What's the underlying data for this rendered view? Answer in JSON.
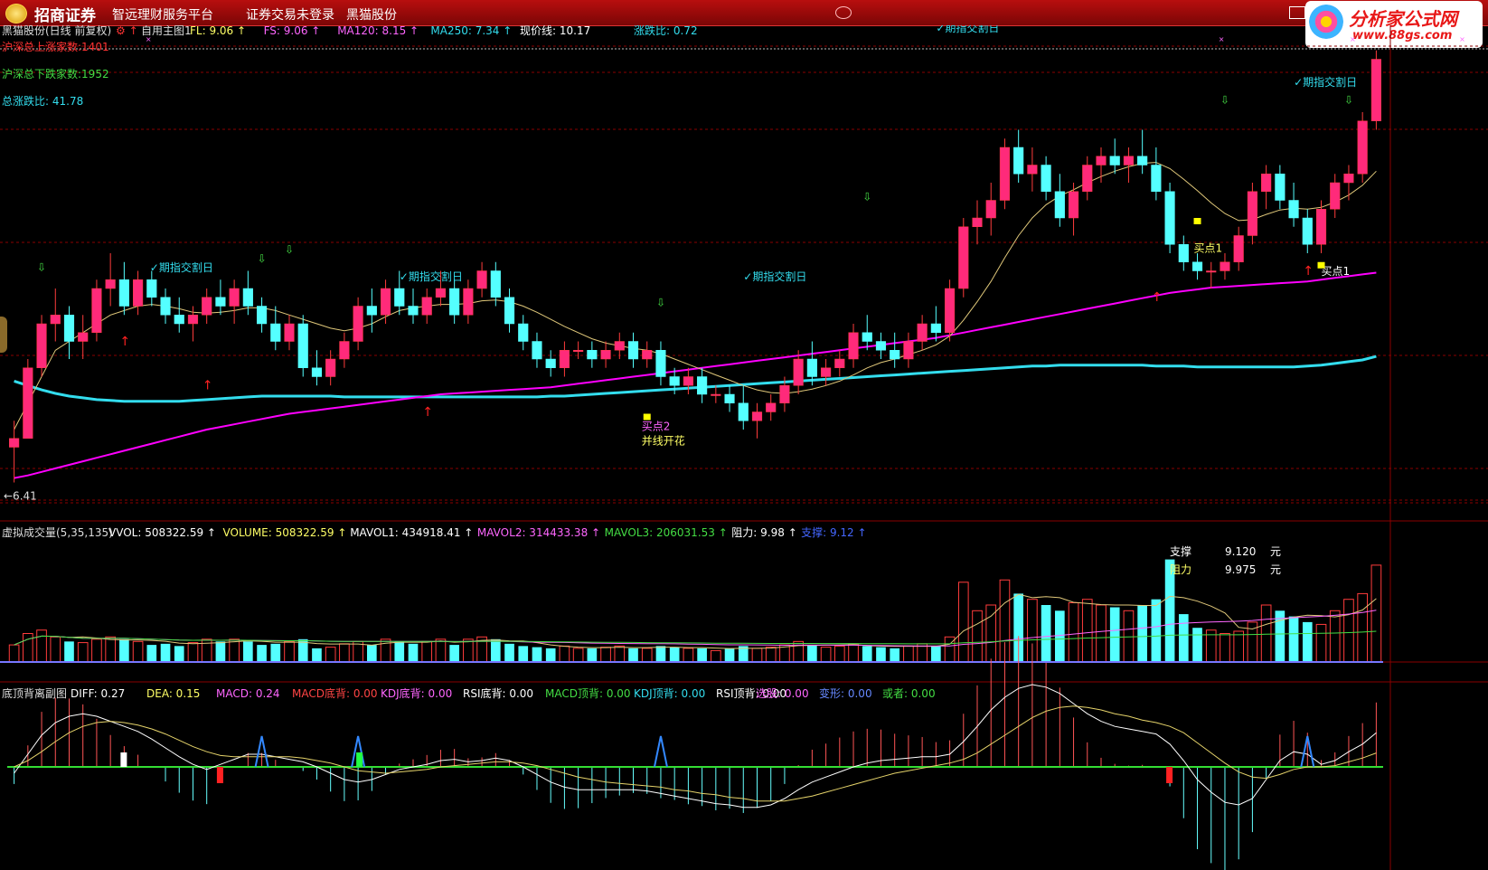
{
  "app": {
    "brand": "招商证券",
    "tagline": "智远理财服务平台",
    "login_status": "证券交易未登录",
    "stock_name": "黑猫股份",
    "watermark_name": "分析家公式网",
    "watermark_url": "www.88gs.com"
  },
  "colors": {
    "up": "#ff3c3c",
    "down": "#54ffff",
    "ma_main": "#e0c87a",
    "ma120": "#ff00ff",
    "ma250": "#33ddee",
    "price_line": "#c8c8c8",
    "grid": "#8a0000",
    "support": "#ffffff",
    "diff": "#ffffff",
    "dea": "#e5d36a",
    "zero_line": "#33dd33"
  },
  "main_panel": {
    "title": "黑猫股份(日线 前复权)",
    "indicator_name": "自用主图1",
    "legend": [
      {
        "text": "FL: 9.06",
        "color": "#ffff66"
      },
      {
        "text": "FS: 9.06",
        "color": "#ff66ff"
      },
      {
        "text": "MA120: 8.15",
        "color": "#ff66ff"
      },
      {
        "text": "MA250: 7.34",
        "color": "#33ddee"
      }
    ],
    "current_price_label": "现价线: 10.17",
    "ratio_label": "涨跌比: 0.72",
    "stats": [
      {
        "text": "沪深总上涨家数:1401",
        "color": "#ff3333"
      },
      {
        "text": "沪深总下跌家数:1952",
        "color": "#44dd44"
      },
      {
        "text": "总涨跌比: 41.78",
        "color": "#33ddee"
      }
    ],
    "low_label": "6.41",
    "expiry_label": "✓期指交割日",
    "buy_label_1": "买点1",
    "buy_label_2": "买点2",
    "blossom_label": "并线开花"
  },
  "volume_panel": {
    "title": "虚拟成交量(5,35,135)",
    "legend": [
      {
        "text": "VVOL: 508322.59",
        "color": "#ffffff"
      },
      {
        "text": "VOLUME: 508322.59",
        "color": "#ffff66"
      },
      {
        "text": "MAVOL1: 434918.41",
        "color": "#ffffff"
      },
      {
        "text": "MAVOL2: 314433.38",
        "color": "#ff66ff"
      },
      {
        "text": "MAVOL3: 206031.53",
        "color": "#44dd44"
      },
      {
        "text": "阻力: 9.98",
        "color": "#ffffff"
      },
      {
        "text": "支撑: 9.12",
        "color": "#4466ff"
      }
    ],
    "support_label": "支撑",
    "support_value": "9.120",
    "resistance_label": "阻力",
    "resistance_value": "9.975",
    "unit": "元"
  },
  "macd_panel": {
    "title": "底顶背离副图",
    "legend": [
      {
        "text": "DIFF: 0.27",
        "color": "#ffffff"
      },
      {
        "text": "DEA: 0.15",
        "color": "#ffff66"
      },
      {
        "text": "MACD: 0.24",
        "color": "#ff66ff"
      },
      {
        "text": "MACD底背: 0.00",
        "color": "#ff4444"
      },
      {
        "text": "KDJ底背: 0.00",
        "color": "#ff66ff"
      },
      {
        "text": "RSI底背: 0.00",
        "color": "#ffffff"
      },
      {
        "text": "MACD顶背: 0.00",
        "color": "#44dd44"
      },
      {
        "text": "KDJ顶背: 0.00",
        "color": "#33ddee"
      },
      {
        "text": "RSI顶背: 0.00",
        "color": "#ffffff"
      },
      {
        "text": "选股: 0.00",
        "color": "#ff66ff"
      },
      {
        "text": "变形: 0.00",
        "color": "#6688ff"
      },
      {
        "text": "或者: 0.00",
        "color": "#44dd44"
      }
    ]
  },
  "chart_data": {
    "type": "candlestick",
    "price_low": 6.41,
    "price_range": [
      6.2,
      11.4
    ],
    "candles": [
      {
        "o": 6.8,
        "h": 7.1,
        "l": 6.4,
        "c": 6.9
      },
      {
        "o": 6.9,
        "h": 7.8,
        "l": 6.9,
        "c": 7.7
      },
      {
        "o": 7.7,
        "h": 8.3,
        "l": 7.6,
        "c": 8.2
      },
      {
        "o": 8.2,
        "h": 8.6,
        "l": 8.0,
        "c": 8.3
      },
      {
        "o": 8.3,
        "h": 8.4,
        "l": 7.8,
        "c": 8.0
      },
      {
        "o": 8.0,
        "h": 8.3,
        "l": 7.8,
        "c": 8.1
      },
      {
        "o": 8.1,
        "h": 8.7,
        "l": 8.0,
        "c": 8.6
      },
      {
        "o": 8.6,
        "h": 9.0,
        "l": 8.4,
        "c": 8.7
      },
      {
        "o": 8.7,
        "h": 8.9,
        "l": 8.3,
        "c": 8.4
      },
      {
        "o": 8.4,
        "h": 8.8,
        "l": 8.3,
        "c": 8.7
      },
      {
        "o": 8.7,
        "h": 8.8,
        "l": 8.4,
        "c": 8.5
      },
      {
        "o": 8.5,
        "h": 8.6,
        "l": 8.2,
        "c": 8.3
      },
      {
        "o": 8.3,
        "h": 8.5,
        "l": 8.1,
        "c": 8.2
      },
      {
        "o": 8.2,
        "h": 8.4,
        "l": 8.0,
        "c": 8.3
      },
      {
        "o": 8.3,
        "h": 8.6,
        "l": 8.2,
        "c": 8.5
      },
      {
        "o": 8.5,
        "h": 8.7,
        "l": 8.3,
        "c": 8.4
      },
      {
        "o": 8.4,
        "h": 8.7,
        "l": 8.2,
        "c": 8.6
      },
      {
        "o": 8.6,
        "h": 8.8,
        "l": 8.3,
        "c": 8.4
      },
      {
        "o": 8.4,
        "h": 8.5,
        "l": 8.1,
        "c": 8.2
      },
      {
        "o": 8.2,
        "h": 8.4,
        "l": 7.9,
        "c": 8.0
      },
      {
        "o": 8.0,
        "h": 8.3,
        "l": 7.9,
        "c": 8.2
      },
      {
        "o": 8.2,
        "h": 8.3,
        "l": 7.6,
        "c": 7.7
      },
      {
        "o": 7.7,
        "h": 7.9,
        "l": 7.5,
        "c": 7.6
      },
      {
        "o": 7.6,
        "h": 7.9,
        "l": 7.5,
        "c": 7.8
      },
      {
        "o": 7.8,
        "h": 8.1,
        "l": 7.7,
        "c": 8.0
      },
      {
        "o": 8.0,
        "h": 8.5,
        "l": 7.9,
        "c": 8.4
      },
      {
        "o": 8.4,
        "h": 8.6,
        "l": 8.1,
        "c": 8.3
      },
      {
        "o": 8.3,
        "h": 8.7,
        "l": 8.2,
        "c": 8.6
      },
      {
        "o": 8.6,
        "h": 8.8,
        "l": 8.3,
        "c": 8.4
      },
      {
        "o": 8.4,
        "h": 8.6,
        "l": 8.2,
        "c": 8.3
      },
      {
        "o": 8.3,
        "h": 8.6,
        "l": 8.2,
        "c": 8.5
      },
      {
        "o": 8.5,
        "h": 8.8,
        "l": 8.4,
        "c": 8.6
      },
      {
        "o": 8.6,
        "h": 8.7,
        "l": 8.2,
        "c": 8.3
      },
      {
        "o": 8.3,
        "h": 8.7,
        "l": 8.2,
        "c": 8.6
      },
      {
        "o": 8.6,
        "h": 8.9,
        "l": 8.5,
        "c": 8.8
      },
      {
        "o": 8.8,
        "h": 8.9,
        "l": 8.4,
        "c": 8.5
      },
      {
        "o": 8.5,
        "h": 8.6,
        "l": 8.1,
        "c": 8.2
      },
      {
        "o": 8.2,
        "h": 8.3,
        "l": 7.9,
        "c": 8.0
      },
      {
        "o": 8.0,
        "h": 8.1,
        "l": 7.7,
        "c": 7.8
      },
      {
        "o": 7.8,
        "h": 7.9,
        "l": 7.6,
        "c": 7.7
      },
      {
        "o": 7.7,
        "h": 8.0,
        "l": 7.6,
        "c": 7.9
      },
      {
        "o": 7.9,
        "h": 8.0,
        "l": 7.8,
        "c": 7.9
      },
      {
        "o": 7.9,
        "h": 8.0,
        "l": 7.7,
        "c": 7.8
      },
      {
        "o": 7.8,
        "h": 8.0,
        "l": 7.7,
        "c": 7.9
      },
      {
        "o": 7.9,
        "h": 8.1,
        "l": 7.8,
        "c": 8.0
      },
      {
        "o": 8.0,
        "h": 8.1,
        "l": 7.7,
        "c": 7.8
      },
      {
        "o": 7.8,
        "h": 8.0,
        "l": 7.7,
        "c": 7.9
      },
      {
        "o": 7.9,
        "h": 8.0,
        "l": 7.5,
        "c": 7.6
      },
      {
        "o": 7.6,
        "h": 7.7,
        "l": 7.4,
        "c": 7.5
      },
      {
        "o": 7.5,
        "h": 7.7,
        "l": 7.4,
        "c": 7.6
      },
      {
        "o": 7.6,
        "h": 7.7,
        "l": 7.3,
        "c": 7.4
      },
      {
        "o": 7.4,
        "h": 7.5,
        "l": 7.3,
        "c": 7.4
      },
      {
        "o": 7.4,
        "h": 7.5,
        "l": 7.2,
        "c": 7.3
      },
      {
        "o": 7.3,
        "h": 7.5,
        "l": 7.0,
        "c": 7.1
      },
      {
        "o": 7.1,
        "h": 7.3,
        "l": 6.9,
        "c": 7.2
      },
      {
        "o": 7.2,
        "h": 7.4,
        "l": 7.1,
        "c": 7.3
      },
      {
        "o": 7.3,
        "h": 7.6,
        "l": 7.2,
        "c": 7.5
      },
      {
        "o": 7.5,
        "h": 7.9,
        "l": 7.4,
        "c": 7.8
      },
      {
        "o": 7.8,
        "h": 8.0,
        "l": 7.5,
        "c": 7.6
      },
      {
        "o": 7.6,
        "h": 7.8,
        "l": 7.5,
        "c": 7.7
      },
      {
        "o": 7.7,
        "h": 7.9,
        "l": 7.6,
        "c": 7.8
      },
      {
        "o": 7.8,
        "h": 8.2,
        "l": 7.7,
        "c": 8.1
      },
      {
        "o": 8.1,
        "h": 8.3,
        "l": 7.9,
        "c": 8.0
      },
      {
        "o": 8.0,
        "h": 8.1,
        "l": 7.8,
        "c": 7.9
      },
      {
        "o": 7.9,
        "h": 8.1,
        "l": 7.7,
        "c": 7.8
      },
      {
        "o": 7.8,
        "h": 8.1,
        "l": 7.7,
        "c": 8.0
      },
      {
        "o": 8.0,
        "h": 8.3,
        "l": 7.9,
        "c": 8.2
      },
      {
        "o": 8.2,
        "h": 8.4,
        "l": 8.0,
        "c": 8.1
      },
      {
        "o": 8.1,
        "h": 8.7,
        "l": 8.0,
        "c": 8.6
      },
      {
        "o": 8.6,
        "h": 9.4,
        "l": 8.5,
        "c": 9.3
      },
      {
        "o": 9.3,
        "h": 9.6,
        "l": 9.1,
        "c": 9.4
      },
      {
        "o": 9.4,
        "h": 9.8,
        "l": 9.2,
        "c": 9.6
      },
      {
        "o": 9.6,
        "h": 10.3,
        "l": 9.5,
        "c": 10.2
      },
      {
        "o": 10.2,
        "h": 10.4,
        "l": 9.8,
        "c": 9.9
      },
      {
        "o": 9.9,
        "h": 10.2,
        "l": 9.7,
        "c": 10.0
      },
      {
        "o": 10.0,
        "h": 10.1,
        "l": 9.6,
        "c": 9.7
      },
      {
        "o": 9.7,
        "h": 9.9,
        "l": 9.3,
        "c": 9.4
      },
      {
        "o": 9.4,
        "h": 9.8,
        "l": 9.2,
        "c": 9.7
      },
      {
        "o": 9.7,
        "h": 10.1,
        "l": 9.6,
        "c": 10.0
      },
      {
        "o": 10.0,
        "h": 10.2,
        "l": 9.8,
        "c": 10.1
      },
      {
        "o": 10.1,
        "h": 10.3,
        "l": 9.9,
        "c": 10.0
      },
      {
        "o": 10.0,
        "h": 10.2,
        "l": 9.8,
        "c": 10.1
      },
      {
        "o": 10.1,
        "h": 10.4,
        "l": 9.9,
        "c": 10.0
      },
      {
        "o": 10.0,
        "h": 10.2,
        "l": 9.6,
        "c": 9.7
      },
      {
        "o": 9.7,
        "h": 9.8,
        "l": 9.0,
        "c": 9.1
      },
      {
        "o": 9.1,
        "h": 9.2,
        "l": 8.8,
        "c": 8.9
      },
      {
        "o": 8.9,
        "h": 9.0,
        "l": 8.7,
        "c": 8.8
      },
      {
        "o": 8.8,
        "h": 8.9,
        "l": 8.6,
        "c": 8.8
      },
      {
        "o": 8.8,
        "h": 9.0,
        "l": 8.7,
        "c": 8.9
      },
      {
        "o": 8.9,
        "h": 9.3,
        "l": 8.8,
        "c": 9.2
      },
      {
        "o": 9.2,
        "h": 9.8,
        "l": 9.1,
        "c": 9.7
      },
      {
        "o": 9.7,
        "h": 10.0,
        "l": 9.5,
        "c": 9.9
      },
      {
        "o": 9.9,
        "h": 10.0,
        "l": 9.5,
        "c": 9.6
      },
      {
        "o": 9.6,
        "h": 9.8,
        "l": 9.3,
        "c": 9.4
      },
      {
        "o": 9.4,
        "h": 9.5,
        "l": 9.0,
        "c": 9.1
      },
      {
        "o": 9.1,
        "h": 9.6,
        "l": 9.0,
        "c": 9.5
      },
      {
        "o": 9.5,
        "h": 9.9,
        "l": 9.4,
        "c": 9.8
      },
      {
        "o": 9.8,
        "h": 10.0,
        "l": 9.6,
        "c": 9.9
      },
      {
        "o": 9.9,
        "h": 10.6,
        "l": 9.8,
        "c": 10.5
      },
      {
        "o": 10.5,
        "h": 11.3,
        "l": 10.4,
        "c": 11.2
      }
    ],
    "ma_main": [
      7.0,
      7.3,
      7.6,
      7.9,
      8.0,
      8.1,
      8.2,
      8.3,
      8.35,
      8.4,
      8.42,
      8.4,
      8.37,
      8.33,
      8.32,
      8.33,
      8.35,
      8.38,
      8.38,
      8.35,
      8.3,
      8.25,
      8.2,
      8.15,
      8.12,
      8.15,
      8.2,
      8.28,
      8.35,
      8.38,
      8.4,
      8.42,
      8.42,
      8.43,
      8.46,
      8.47,
      8.45,
      8.4,
      8.33,
      8.25,
      8.17,
      8.1,
      8.03,
      7.98,
      7.95,
      7.92,
      7.9,
      7.86,
      7.8,
      7.74,
      7.68,
      7.62,
      7.56,
      7.5,
      7.45,
      7.42,
      7.41,
      7.43,
      7.46,
      7.5,
      7.55,
      7.62,
      7.7,
      7.76,
      7.8,
      7.85,
      7.9,
      7.96,
      8.06,
      8.24,
      8.45,
      8.68,
      8.95,
      9.2,
      9.4,
      9.55,
      9.65,
      9.72,
      9.8,
      9.87,
      9.93,
      9.98,
      10.02,
      10.03,
      9.96,
      9.84,
      9.71,
      9.57,
      9.45,
      9.37,
      9.38,
      9.44,
      9.49,
      9.51,
      9.5,
      9.52,
      9.58,
      9.66,
      9.77,
      9.93
    ],
    "ma120": [
      6.45,
      6.48,
      6.52,
      6.56,
      6.6,
      6.64,
      6.68,
      6.72,
      6.76,
      6.8,
      6.84,
      6.88,
      6.92,
      6.96,
      7.0,
      7.03,
      7.06,
      7.09,
      7.12,
      7.15,
      7.18,
      7.2,
      7.22,
      7.24,
      7.26,
      7.28,
      7.3,
      7.32,
      7.34,
      7.36,
      7.38,
      7.4,
      7.41,
      7.42,
      7.43,
      7.44,
      7.45,
      7.46,
      7.47,
      7.48,
      7.5,
      7.52,
      7.54,
      7.56,
      7.58,
      7.6,
      7.62,
      7.64,
      7.66,
      7.68,
      7.7,
      7.72,
      7.74,
      7.76,
      7.78,
      7.8,
      7.82,
      7.84,
      7.86,
      7.88,
      7.9,
      7.92,
      7.94,
      7.96,
      7.98,
      8.0,
      8.02,
      8.04,
      8.07,
      8.1,
      8.13,
      8.16,
      8.19,
      8.22,
      8.25,
      8.28,
      8.31,
      8.34,
      8.37,
      8.4,
      8.43,
      8.46,
      8.49,
      8.52,
      8.55,
      8.57,
      8.59,
      8.61,
      8.62,
      8.63,
      8.64,
      8.65,
      8.66,
      8.67,
      8.68,
      8.7,
      8.72,
      8.74,
      8.76,
      8.78
    ],
    "ma250": [
      7.55,
      7.5,
      7.45,
      7.41,
      7.38,
      7.36,
      7.34,
      7.33,
      7.32,
      7.32,
      7.32,
      7.32,
      7.32,
      7.33,
      7.34,
      7.35,
      7.36,
      7.37,
      7.38,
      7.38,
      7.38,
      7.38,
      7.38,
      7.38,
      7.37,
      7.37,
      7.37,
      7.37,
      7.37,
      7.37,
      7.37,
      7.37,
      7.37,
      7.37,
      7.37,
      7.37,
      7.37,
      7.37,
      7.37,
      7.38,
      7.38,
      7.39,
      7.4,
      7.41,
      7.42,
      7.43,
      7.44,
      7.45,
      7.46,
      7.47,
      7.48,
      7.49,
      7.5,
      7.51,
      7.52,
      7.53,
      7.54,
      7.55,
      7.56,
      7.57,
      7.58,
      7.59,
      7.6,
      7.61,
      7.62,
      7.63,
      7.64,
      7.65,
      7.66,
      7.67,
      7.68,
      7.69,
      7.7,
      7.71,
      7.72,
      7.72,
      7.73,
      7.73,
      7.73,
      7.73,
      7.73,
      7.73,
      7.73,
      7.72,
      7.72,
      7.72,
      7.71,
      7.71,
      7.71,
      7.71,
      7.71,
      7.71,
      7.71,
      7.71,
      7.72,
      7.73,
      7.75,
      7.77,
      7.79,
      7.83
    ],
    "volumes": [
      0.15,
      0.25,
      0.28,
      0.22,
      0.18,
      0.17,
      0.2,
      0.22,
      0.2,
      0.18,
      0.15,
      0.16,
      0.14,
      0.17,
      0.2,
      0.18,
      0.2,
      0.18,
      0.15,
      0.16,
      0.18,
      0.2,
      0.12,
      0.13,
      0.16,
      0.18,
      0.15,
      0.2,
      0.18,
      0.16,
      0.18,
      0.2,
      0.15,
      0.2,
      0.22,
      0.2,
      0.16,
      0.14,
      0.13,
      0.12,
      0.14,
      0.12,
      0.12,
      0.13,
      0.14,
      0.12,
      0.12,
      0.14,
      0.13,
      0.12,
      0.12,
      0.1,
      0.12,
      0.14,
      0.12,
      0.13,
      0.15,
      0.18,
      0.15,
      0.13,
      0.14,
      0.16,
      0.14,
      0.13,
      0.12,
      0.14,
      0.16,
      0.14,
      0.22,
      0.7,
      0.45,
      0.5,
      0.72,
      0.6,
      0.55,
      0.5,
      0.45,
      0.52,
      0.55,
      0.5,
      0.48,
      0.45,
      0.5,
      0.55,
      0.9,
      0.42,
      0.3,
      0.28,
      0.25,
      0.27,
      0.35,
      0.5,
      0.45,
      0.4,
      0.35,
      0.33,
      0.45,
      0.55,
      0.6,
      0.85
    ],
    "support": 9.12,
    "resistance": 9.98,
    "macd_diff": [
      -0.05,
      0.1,
      0.25,
      0.35,
      0.4,
      0.42,
      0.4,
      0.36,
      0.32,
      0.28,
      0.22,
      0.15,
      0.08,
      0.02,
      -0.02,
      0.02,
      0.06,
      0.1,
      0.1,
      0.08,
      0.06,
      0.04,
      0.0,
      -0.05,
      -0.1,
      -0.12,
      -0.1,
      -0.06,
      -0.02,
      0.0,
      0.02,
      0.05,
      0.06,
      0.04,
      0.05,
      0.07,
      0.05,
      0.0,
      -0.06,
      -0.12,
      -0.16,
      -0.18,
      -0.18,
      -0.18,
      -0.18,
      -0.18,
      -0.19,
      -0.21,
      -0.23,
      -0.25,
      -0.27,
      -0.29,
      -0.3,
      -0.32,
      -0.32,
      -0.3,
      -0.25,
      -0.18,
      -0.12,
      -0.08,
      -0.04,
      0.0,
      0.03,
      0.05,
      0.06,
      0.07,
      0.08,
      0.08,
      0.1,
      0.2,
      0.32,
      0.45,
      0.55,
      0.62,
      0.65,
      0.63,
      0.58,
      0.5,
      0.42,
      0.36,
      0.32,
      0.3,
      0.28,
      0.26,
      0.18,
      0.05,
      -0.1,
      -0.2,
      -0.28,
      -0.3,
      -0.25,
      -0.1,
      0.05,
      0.12,
      0.1,
      0.02,
      0.05,
      0.12,
      0.18,
      0.27
    ],
    "macd_dea": [
      0.0,
      0.05,
      0.12,
      0.2,
      0.27,
      0.32,
      0.35,
      0.36,
      0.35,
      0.33,
      0.3,
      0.26,
      0.21,
      0.16,
      0.12,
      0.09,
      0.08,
      0.08,
      0.08,
      0.08,
      0.08,
      0.07,
      0.05,
      0.03,
      0.0,
      -0.03,
      -0.04,
      -0.05,
      -0.04,
      -0.03,
      -0.02,
      0.0,
      0.01,
      0.02,
      0.03,
      0.04,
      0.04,
      0.03,
      0.01,
      -0.02,
      -0.05,
      -0.08,
      -0.1,
      -0.12,
      -0.13,
      -0.14,
      -0.15,
      -0.16,
      -0.18,
      -0.19,
      -0.21,
      -0.22,
      -0.24,
      -0.25,
      -0.27,
      -0.27,
      -0.27,
      -0.25,
      -0.23,
      -0.2,
      -0.17,
      -0.14,
      -0.11,
      -0.08,
      -0.05,
      -0.03,
      -0.01,
      0.01,
      0.03,
      0.06,
      0.11,
      0.18,
      0.25,
      0.32,
      0.39,
      0.44,
      0.47,
      0.48,
      0.47,
      0.45,
      0.42,
      0.4,
      0.37,
      0.35,
      0.32,
      0.27,
      0.19,
      0.11,
      0.03,
      -0.04,
      -0.08,
      -0.09,
      -0.06,
      -0.02,
      0.0,
      0.0,
      0.01,
      0.04,
      0.07,
      0.11
    ]
  }
}
